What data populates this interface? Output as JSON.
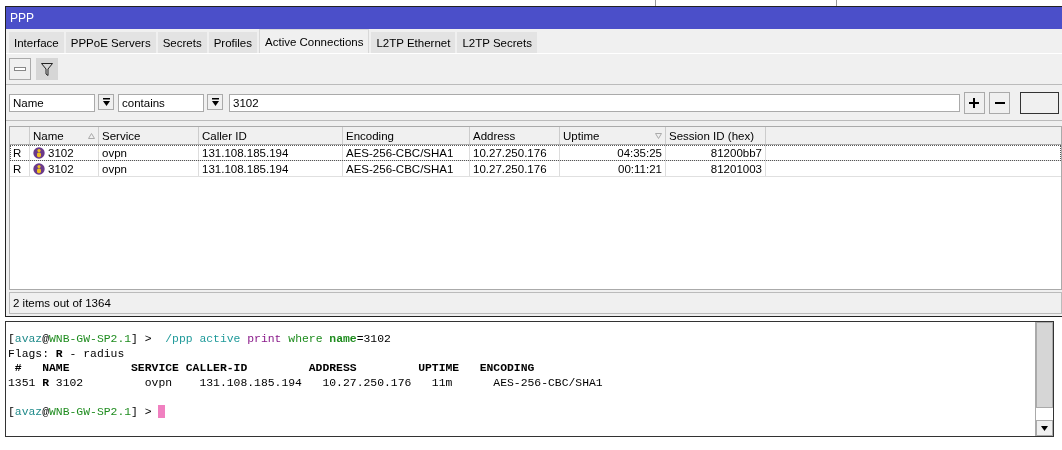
{
  "window": {
    "title": "PPP"
  },
  "tabs": [
    {
      "label": "Interface",
      "selected": false
    },
    {
      "label": "PPPoE Servers",
      "selected": false
    },
    {
      "label": "Secrets",
      "selected": false
    },
    {
      "label": "Profiles",
      "selected": false
    },
    {
      "label": "Active Connections",
      "selected": true
    },
    {
      "label": "L2TP Ethernet",
      "selected": false
    },
    {
      "label": "L2TP Secrets",
      "selected": false
    }
  ],
  "toolbar": [
    {
      "kind": "remove",
      "selected": false
    },
    {
      "kind": "filter",
      "selected": true
    }
  ],
  "filter": {
    "field": "Name",
    "operator": "contains",
    "value": "3102"
  },
  "table": {
    "columns": [
      {
        "label": "Name",
        "sorted_ascending": true,
        "sorted_descending": false
      },
      {
        "label": "Service",
        "sorted_ascending": false,
        "sorted_descending": false
      },
      {
        "label": "Caller ID",
        "sorted_ascending": false,
        "sorted_descending": false
      },
      {
        "label": "Encoding",
        "sorted_ascending": false,
        "sorted_descending": false
      },
      {
        "label": "Address",
        "sorted_ascending": false,
        "sorted_descending": false
      },
      {
        "label": "Uptime",
        "sorted_ascending": false,
        "sorted_descending": true
      },
      {
        "label": "Session ID (hex)",
        "sorted_ascending": false,
        "sorted_descending": false
      }
    ],
    "rows": [
      {
        "flag": "R",
        "focused": true,
        "cells": [
          "3102",
          "ovpn",
          "131.108.185.194",
          "AES-256-CBC/SHA1",
          "10.27.250.176",
          "04:35:25",
          "81200bb7"
        ]
      },
      {
        "flag": "R",
        "focused": false,
        "cells": [
          "3102",
          "ovpn",
          "131.108.185.194",
          "AES-256-CBC/SHA1",
          "10.27.250.176",
          "00:11:21",
          "81201003"
        ]
      }
    ]
  },
  "status_bar": "2 items out of 1364",
  "terminal": {
    "lines": [
      {
        "gap_before": false,
        "segments": [
          {
            "kind": "plain",
            "text": "["
          },
          {
            "kind": "user",
            "text": "avaz"
          },
          {
            "kind": "plain",
            "text": "@"
          },
          {
            "kind": "host",
            "text": "WNB-GW-SP2.1"
          },
          {
            "kind": "plain",
            "text": "] >  "
          },
          {
            "kind": "path",
            "text": "/ppp active "
          },
          {
            "kind": "verb",
            "text": "print "
          },
          {
            "kind": "keyword",
            "text": "where "
          },
          {
            "kind": "arg",
            "text": "name"
          },
          {
            "kind": "plain",
            "text": "=3102"
          }
        ]
      },
      {
        "gap_before": false,
        "segments": [
          {
            "kind": "plain",
            "text": "Flags: "
          },
          {
            "kind": "bold",
            "text": "R"
          },
          {
            "kind": "plain",
            "text": " - radius"
          }
        ]
      },
      {
        "gap_before": false,
        "segments": [
          {
            "kind": "bold",
            "text": " #   NAME         SERVICE CALLER-ID         ADDRESS         UPTIME   ENCODING"
          }
        ]
      },
      {
        "gap_before": false,
        "segments": [
          {
            "kind": "plain",
            "text": "1351 "
          },
          {
            "kind": "bold",
            "text": "R"
          },
          {
            "kind": "plain",
            "text": " 3102         ovpn    131.108.185.194   10.27.250.176   11m      AES-256-CBC/SHA1"
          }
        ]
      },
      {
        "gap_before": true,
        "segments": [
          {
            "kind": "plain",
            "text": "["
          },
          {
            "kind": "user",
            "text": "avaz"
          },
          {
            "kind": "plain",
            "text": "@"
          },
          {
            "kind": "host",
            "text": "WNB-GW-SP2.1"
          },
          {
            "kind": "plain",
            "text": "] > "
          }
        ]
      }
    ],
    "cursor": true
  }
}
